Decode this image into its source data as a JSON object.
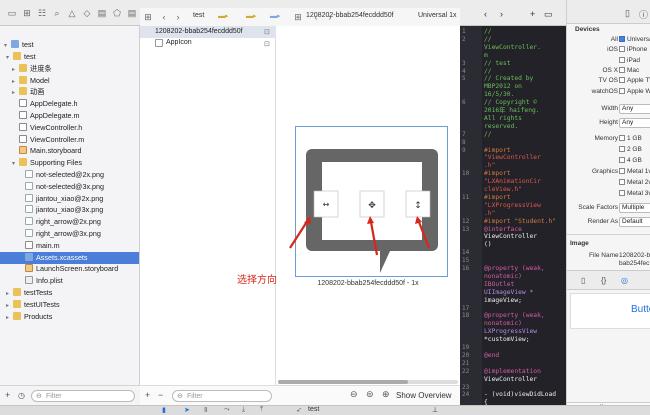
{
  "nav": {
    "root": "test",
    "items": [
      {
        "label": "test",
        "kind": "folder",
        "indent": 1,
        "disc": "▾"
      },
      {
        "label": "进度条",
        "kind": "folder",
        "indent": 2,
        "disc": "▸"
      },
      {
        "label": "Model",
        "kind": "folder",
        "indent": 2,
        "disc": "▸"
      },
      {
        "label": "动画",
        "kind": "folder",
        "indent": 2,
        "disc": "▸"
      },
      {
        "label": "AppDelegate.h",
        "kind": "h",
        "indent": 2
      },
      {
        "label": "AppDelegate.m",
        "kind": "m",
        "indent": 2
      },
      {
        "label": "ViewController.h",
        "kind": "h",
        "indent": 2
      },
      {
        "label": "ViewController.m",
        "kind": "m",
        "indent": 2
      },
      {
        "label": "Main.storyboard",
        "kind": "sb",
        "indent": 2
      },
      {
        "label": "Supporting Files",
        "kind": "folder",
        "indent": 2,
        "disc": "▾"
      },
      {
        "label": "not-selected@2x.png",
        "kind": "png",
        "indent": 3
      },
      {
        "label": "not-selected@3x.png",
        "kind": "png",
        "indent": 3
      },
      {
        "label": "jiantou_xiao@2x.png",
        "kind": "png",
        "indent": 3
      },
      {
        "label": "jiantou_xiao@3x.png",
        "kind": "png",
        "indent": 3
      },
      {
        "label": "right_arrow@2x.png",
        "kind": "png",
        "indent": 3
      },
      {
        "label": "right_arrow@3x.png",
        "kind": "png",
        "indent": 3
      },
      {
        "label": "main.m",
        "kind": "m",
        "indent": 3
      },
      {
        "label": "Assets.xcassets",
        "kind": "xc",
        "indent": 3,
        "selected": true
      },
      {
        "label": "LaunchScreen.storyboard",
        "kind": "sb",
        "indent": 3
      },
      {
        "label": "Info.plist",
        "kind": "plist",
        "indent": 3
      },
      {
        "label": "testTests",
        "kind": "folder",
        "indent": 1,
        "disc": "▸"
      },
      {
        "label": "testUITests",
        "kind": "folder",
        "indent": 1,
        "disc": "▸"
      },
      {
        "label": "Products",
        "kind": "folder",
        "indent": 1,
        "disc": "▸"
      }
    ],
    "filter_placeholder": "Filter"
  },
  "breadcrumb": {
    "project": "test",
    "asset": "1208202-bbab254fecddd50f",
    "scale": "Universal 1x"
  },
  "catalog": {
    "selected": "1208202-bbab254fecddd50f",
    "appicon": "AppIcon"
  },
  "canvas": {
    "image_label": "1208202-bbab254fecddd50f - 1x",
    "annotation": "选择方向",
    "show_overview": "Show Overview"
  },
  "code": {
    "lines": [
      {
        "n": "1",
        "t": "//",
        "c": "#6bbf59"
      },
      {
        "n": "2",
        "t": "//",
        "c": "#6bbf59"
      },
      {
        "n": "",
        "t": "   ViewController.",
        "c": "#6bbf59"
      },
      {
        "n": "",
        "t": "   m",
        "c": "#6bbf59"
      },
      {
        "n": "3",
        "t": "//  test",
        "c": "#6bbf59"
      },
      {
        "n": "4",
        "t": "//",
        "c": "#6bbf59"
      },
      {
        "n": "5",
        "t": "//  Created by",
        "c": "#6bbf59"
      },
      {
        "n": "",
        "t": "   MBP2012 on",
        "c": "#6bbf59"
      },
      {
        "n": "",
        "t": "   16/5/30.",
        "c": "#6bbf59"
      },
      {
        "n": "6",
        "t": "//  Copyright ©",
        "c": "#6bbf59"
      },
      {
        "n": "",
        "t": "   2016年 haifeng.",
        "c": "#6bbf59"
      },
      {
        "n": "",
        "t": "   All rights",
        "c": "#6bbf59"
      },
      {
        "n": "",
        "t": "   reserved.",
        "c": "#6bbf59"
      },
      {
        "n": "7",
        "t": "//",
        "c": "#6bbf59"
      },
      {
        "n": "8",
        "t": "",
        "c": "#ddd"
      },
      {
        "n": "9",
        "t": "#import",
        "c": "#d27a3c"
      },
      {
        "n": "",
        "t": "   \"ViewController",
        "c": "#e0584a"
      },
      {
        "n": "",
        "t": "   .h\"",
        "c": "#e0584a"
      },
      {
        "n": "10",
        "t": "#import",
        "c": "#d27a3c"
      },
      {
        "n": "",
        "t": "   \"LXAnimationCir",
        "c": "#e0584a"
      },
      {
        "n": "",
        "t": "   cleView.h\"",
        "c": "#e0584a"
      },
      {
        "n": "11",
        "t": "#import",
        "c": "#d27a3c"
      },
      {
        "n": "",
        "t": "   \"LXProgressView",
        "c": "#e0584a"
      },
      {
        "n": "",
        "t": "   .h\"",
        "c": "#e0584a"
      },
      {
        "n": "12",
        "t": "#import \"Student.h\"",
        "c": "#d27a3c"
      },
      {
        "n": "13",
        "t": "@interface",
        "c": "#d65ca8"
      },
      {
        "n": "",
        "t": "   ViewController",
        "c": "#eee"
      },
      {
        "n": "",
        "t": "   ()",
        "c": "#eee"
      },
      {
        "n": "14",
        "t": "",
        "c": "#ddd"
      },
      {
        "n": "15",
        "t": "",
        "c": "#ddd"
      },
      {
        "n": "16",
        "t": "@property (weak,",
        "c": "#d65ca8"
      },
      {
        "n": "",
        "t": "   nonatomic)",
        "c": "#d65ca8"
      },
      {
        "n": "",
        "t": "   IBOutlet",
        "c": "#d65ca8"
      },
      {
        "n": "",
        "t": "   UIImageView *",
        "c": "#b68ae6"
      },
      {
        "n": "",
        "t": "   imageView;",
        "c": "#eee"
      },
      {
        "n": "17",
        "t": "",
        "c": "#ddd"
      },
      {
        "n": "18",
        "t": "@property (weak,",
        "c": "#d65ca8"
      },
      {
        "n": "",
        "t": "   nonatomic)",
        "c": "#d65ca8"
      },
      {
        "n": "",
        "t": "   LXProgressView",
        "c": "#b68ae6"
      },
      {
        "n": "",
        "t": "   *customView;",
        "c": "#eee"
      },
      {
        "n": "19",
        "t": "",
        "c": "#ddd"
      },
      {
        "n": "20",
        "t": "@end",
        "c": "#d65ca8"
      },
      {
        "n": "21",
        "t": "",
        "c": "#ddd"
      },
      {
        "n": "22",
        "t": "@implementation",
        "c": "#d65ca8"
      },
      {
        "n": "",
        "t": "   ViewController",
        "c": "#eee"
      },
      {
        "n": "23",
        "t": "",
        "c": "#ddd"
      },
      {
        "n": "24",
        "t": "- (void)viewDidLoad",
        "c": "#eee"
      },
      {
        "n": "",
        "t": "   {",
        "c": "#eee"
      },
      {
        "n": "25",
        "t": "   [super",
        "c": "#d65ca8"
      }
    ]
  },
  "inspector": {
    "devices_title": "Devices",
    "devices": [
      {
        "label": "All",
        "value": "Universal",
        "checked": true
      },
      {
        "label": "iOS",
        "value": "iPhone",
        "checked": false
      },
      {
        "label": "",
        "value": "iPad",
        "checked": false
      },
      {
        "label": "OS X",
        "value": "Mac",
        "checked": false
      },
      {
        "label": "TV OS",
        "value": "Apple TV",
        "checked": false
      },
      {
        "label": "watchOS",
        "value": "Apple Watch",
        "checked": false
      }
    ],
    "width_label": "Width",
    "width_value": "Any",
    "height_label": "Height",
    "height_value": "Any",
    "memory_label": "Memory",
    "memory": [
      "1 GB",
      "2 GB",
      "4 GB"
    ],
    "graphics_label": "Graphics",
    "graphics": [
      "Metal 1v2",
      "Metal 2v2",
      "Metal 3v1"
    ],
    "scale_label": "Scale Factors",
    "scale_value": "Multiple",
    "render_label": "Render As",
    "render_value": "Default",
    "image_title": "Image",
    "filename_label": "File Name",
    "filename_value": "1208202-bbab254fecddd50f",
    "button_label": "Button",
    "lib_item": "uibutton"
  }
}
